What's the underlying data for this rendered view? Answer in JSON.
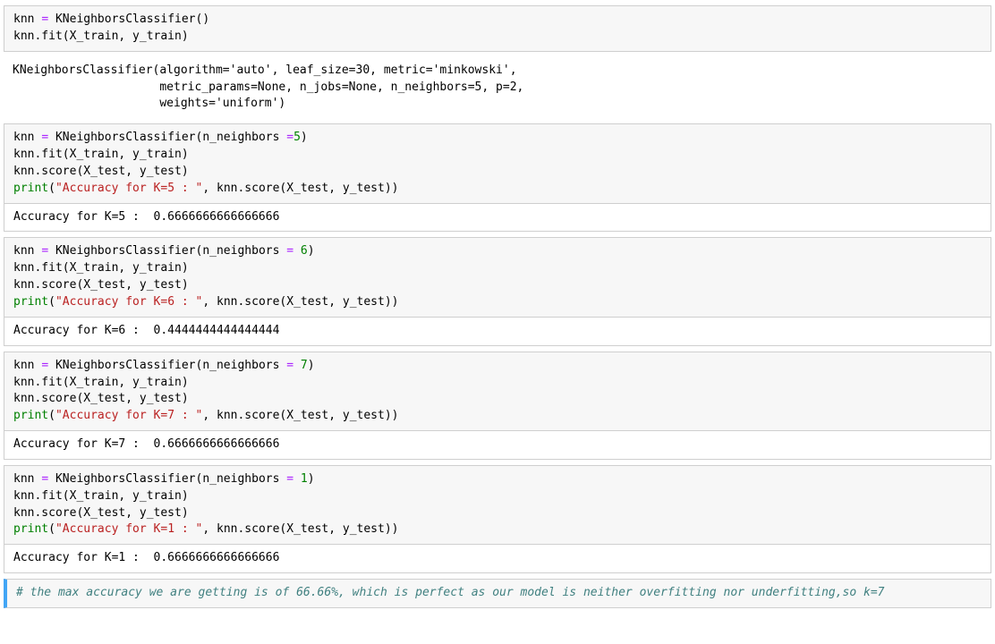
{
  "cells": {
    "c0": {
      "code_html": "knn <span class='op'>=</span> KNeighborsClassifier<span class='paren'>()</span>\nknn.fit(X_train, y_train<span class='paren'>)</span>"
    },
    "c1": {
      "plain": "KNeighborsClassifier(algorithm='auto', leaf_size=30, metric='minkowski',\n                     metric_params=None, n_jobs=None, n_neighbors=5, p=2,\n                     weights='uniform')"
    },
    "c2": {
      "code_html": "knn <span class='op'>=</span> KNeighborsClassifier(n_neighbors <span class='op'>=</span><span class='num'>5</span>)\nknn.fit(X_train, y_train)\nknn.score(X_test, y_test)\n<span class='pr'>print</span>(<span class='s'>\"Accuracy for K=5 : \"</span>, knn.score(X_test, y_test))",
      "output": "Accuracy for K=5 :  0.6666666666666666"
    },
    "c3": {
      "code_html": "knn <span class='op'>=</span> KNeighborsClassifier(n_neighbors <span class='op'>=</span> <span class='num'>6</span>)\nknn.fit(X_train, y_train)\nknn.score(X_test, y_test)\n<span class='pr'>print</span>(<span class='s'>\"Accuracy for K=6 : \"</span>, knn.score(X_test, y_test))",
      "output": "Accuracy for K=6 :  0.4444444444444444"
    },
    "c4": {
      "code_html": "knn <span class='op'>=</span> KNeighborsClassifier(n_neighbors <span class='op'>=</span> <span class='num'>7</span>)\nknn.fit(X_train, y_train)\nknn.score(X_test, y_test)\n<span class='pr'>print</span>(<span class='s'>\"Accuracy for K=7 : \"</span>, knn.score(X_test, y_test))",
      "output": "Accuracy for K=7 :  0.6666666666666666"
    },
    "c5": {
      "code_html": "knn <span class='op'>=</span> KNeighborsClassifier(n_neighbors <span class='op'>=</span> <span class='num'>1</span>)\nknn.fit(X_train, y_train)\nknn.score(X_test, y_test)\n<span class='pr'>print</span>(<span class='s'>\"Accuracy for K=1 : \"</span>, knn.score(X_test, y_test))",
      "output": "Accuracy for K=1 :  0.6666666666666666"
    },
    "c6": {
      "code_html": "<span class='cm'># the max accuracy we are getting is of 66.66%, which is perfect as our model is neither overfitting nor underfitting,so k=7</span>"
    }
  }
}
